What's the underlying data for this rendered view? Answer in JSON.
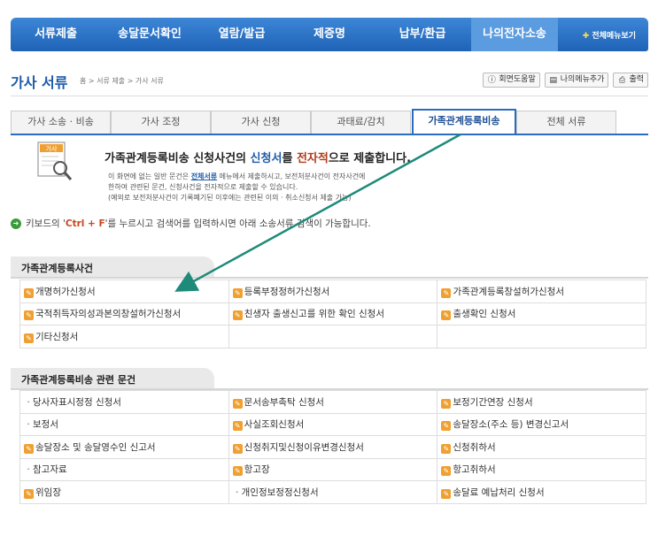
{
  "nav": {
    "items": [
      "서류제출",
      "송달문서확인",
      "열람/발급",
      "제증명",
      "납부/환급",
      "나의전자소송"
    ],
    "active_index": 5,
    "all_menu": "전체메뉴보기"
  },
  "header": {
    "title": "가사 서류",
    "breadcrumb": "홈 > 서류 제출 > 가사 서류",
    "tools": [
      "회면도움말",
      "나의메뉴추가",
      "출력"
    ]
  },
  "tabs": [
    "가사 소송 · 비송",
    "가사 조정",
    "가사 신청",
    "과태료/감치",
    "가족관계등록비송",
    "전체 서류"
  ],
  "active_tab": 4,
  "intro": {
    "icon_label": "가사",
    "heading_pre": "가족관계등록비송 신청사건의 ",
    "heading_hl1": "신청서",
    "heading_mid": "를 ",
    "heading_hl2": "전자적",
    "heading_post": "으로 제출합니다.",
    "desc_line1_pre": "이 화면에 없는 일반 문건은 ",
    "desc_link": "전체서류",
    "desc_line1_post": " 메뉴에서 제출하시고, 보전처분사건이 전자사건에",
    "desc_line2": "한하여 관련된 문건, 신청사건을 전자적으로 제출할 수 있습니다.",
    "desc_line3": "(예외로 보전처분사건이 기록폐기된 이후에는 관련된 이의 · 취소신청서 제출 가능)"
  },
  "keyboard_note": {
    "pre": "키보드의 '",
    "key": "Ctrl + F",
    "post": "'를 누르시고 검색어를 입력하시면 아래 소송서류 검색이 가능합니다."
  },
  "section1": {
    "title": "가족관계등록사건",
    "rows": [
      [
        {
          "t": "개명허가신청서",
          "icon": true
        },
        {
          "t": "등록부정정허가신청서",
          "icon": true
        },
        {
          "t": "가족관계등록창설허가신청서",
          "icon": true
        }
      ],
      [
        {
          "t": "국적취득자의성과본의창설허가신청서",
          "icon": true
        },
        {
          "t": "친생자 출생신고를 위한 확인 신청서",
          "icon": true
        },
        {
          "t": "출생확인 신청서",
          "icon": true
        }
      ],
      [
        {
          "t": "기타신청서",
          "icon": true
        },
        {
          "t": "",
          "icon": false
        },
        {
          "t": "",
          "icon": false
        }
      ]
    ]
  },
  "section2": {
    "title": "가족관계등록비송 관련 문건",
    "rows": [
      [
        {
          "t": "당사자표시정정 신청서",
          "icon": false
        },
        {
          "t": "문서송부촉탁 신청서",
          "icon": true
        },
        {
          "t": "보정기간연장 신청서",
          "icon": true
        }
      ],
      [
        {
          "t": "보정서",
          "icon": false
        },
        {
          "t": "사실조회신청서",
          "icon": true
        },
        {
          "t": "송달장소(주소 등) 변경신고서",
          "icon": true
        }
      ],
      [
        {
          "t": "송달장소 및 송달영수인 신고서",
          "icon": true
        },
        {
          "t": "신청취지및신청이유변경신청서",
          "icon": true
        },
        {
          "t": "신청취하서",
          "icon": true
        }
      ],
      [
        {
          "t": "참고자료",
          "icon": false
        },
        {
          "t": "항고장",
          "icon": true
        },
        {
          "t": "항고취하서",
          "icon": true
        }
      ],
      [
        {
          "t": "위임장",
          "icon": true
        },
        {
          "t": "개인정보정정신청서",
          "icon": false
        },
        {
          "t": "송달료 예납처리 신청서",
          "icon": true
        }
      ]
    ]
  },
  "colors": {
    "nav_bg": "#2a6cc1",
    "accent": "#1e5ba8",
    "doc_icon": "#f0a030",
    "arrow": "#1e8a7a"
  }
}
